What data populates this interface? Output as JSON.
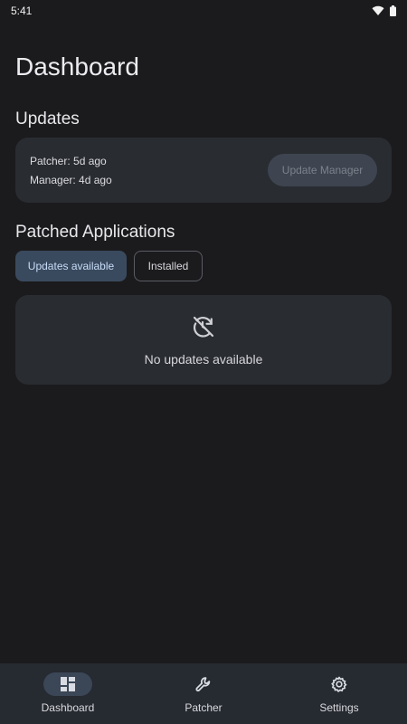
{
  "status_bar": {
    "time": "5:41"
  },
  "page_title": "Dashboard",
  "updates_section": {
    "title": "Updates",
    "patcher_line": "Patcher: 5d ago",
    "manager_line": "Manager: 4d ago",
    "update_button": "Update Manager"
  },
  "patched_section": {
    "title": "Patched Applications",
    "chips": [
      {
        "label": "Updates available",
        "selected": true
      },
      {
        "label": "Installed",
        "selected": false
      }
    ],
    "empty_message": "No updates available"
  },
  "bottom_nav": {
    "items": [
      {
        "label": "Dashboard",
        "icon": "dashboard-icon",
        "active": true
      },
      {
        "label": "Patcher",
        "icon": "wrench-icon",
        "active": false
      },
      {
        "label": "Settings",
        "icon": "gear-icon",
        "active": false
      }
    ]
  },
  "colors": {
    "background": "#1b1b1d",
    "card": "#292c31",
    "nav_background": "#262a31",
    "chip_selected": "#3a4a5e",
    "chip_selected_text": "#c7dcf7",
    "nav_active_pill": "#3b4656"
  }
}
